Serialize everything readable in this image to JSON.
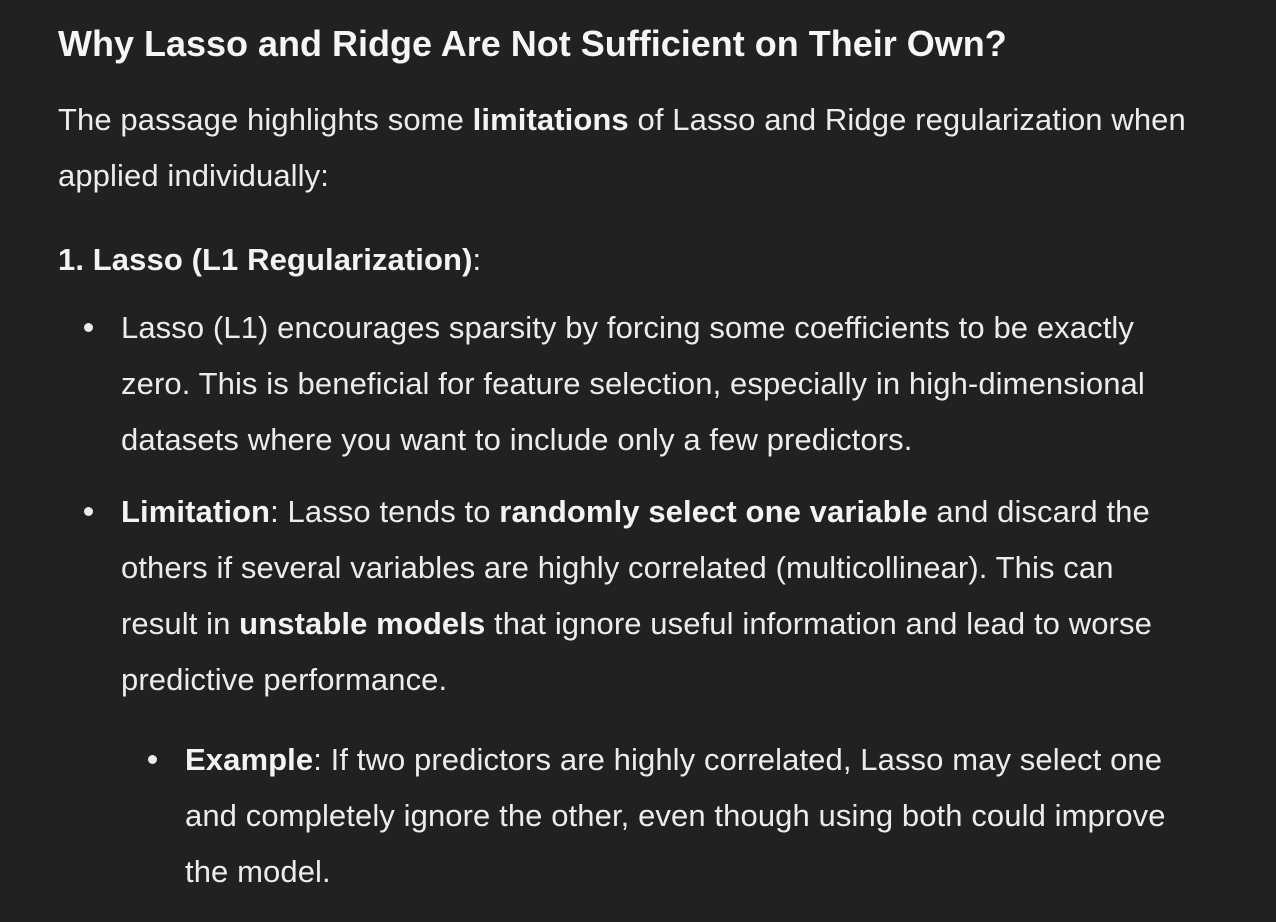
{
  "heading": "Why Lasso and Ridge Are Not Sufficient on Their Own?",
  "intro": {
    "l1_a": "The passage highlights some ",
    "l1_b": "limitations",
    "l1_c": " of Lasso and Ridge regularization when",
    "l2": "applied individually:"
  },
  "section1": {
    "title_bold": "1. Lasso (L1 Regularization)",
    "title_tail": ":"
  },
  "bullet1": {
    "l1": "Lasso (L1) encourages sparsity by forcing some coefficients to be exactly",
    "l2": "zero. This is beneficial for feature selection, especially in high-dimensional",
    "l3": "datasets where you want to include only a few predictors."
  },
  "bullet2": {
    "l1_a": "Limitation",
    "l1_b": ": Lasso tends to ",
    "l1_c": "randomly select one variable",
    "l1_d": " and discard the",
    "l2": "others if several variables are highly correlated (multicollinear). This can",
    "l3_a": "result in ",
    "l3_b": "unstable models",
    "l3_c": " that ignore useful information and lead to worse",
    "l4": "predictive performance."
  },
  "subbullet1": {
    "l1_a": "Example",
    "l1_b": ": If two predictors are highly correlated, Lasso may select one",
    "l2": "and completely ignore the other, even though using both could improve",
    "l3": "the model."
  }
}
